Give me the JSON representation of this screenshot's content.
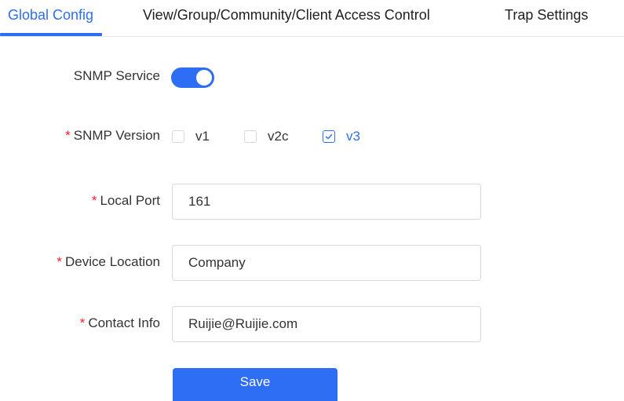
{
  "tabs": [
    {
      "label": "Global Config",
      "active": true
    },
    {
      "label": "View/Group/Community/Client Access Control",
      "active": false
    },
    {
      "label": "Trap Settings",
      "active": false
    }
  ],
  "form": {
    "snmp_service": {
      "label": "SNMP Service",
      "enabled": true
    },
    "snmp_version": {
      "required_mark": "*",
      "label": "SNMP Version",
      "options": [
        {
          "label": "v1",
          "checked": false
        },
        {
          "label": "v2c",
          "checked": false
        },
        {
          "label": "v3",
          "checked": true
        }
      ]
    },
    "local_port": {
      "required_mark": "*",
      "label": "Local Port",
      "value": "161"
    },
    "device_location": {
      "required_mark": "*",
      "label": "Device Location",
      "value": "Company"
    },
    "contact_info": {
      "required_mark": "*",
      "label": "Contact Info",
      "value": "Ruijie@Ruijie.com"
    }
  },
  "save_label": "Save",
  "colors": {
    "accent": "#2d6ef5",
    "required": "#f5222d",
    "border": "#d9d9d9"
  }
}
